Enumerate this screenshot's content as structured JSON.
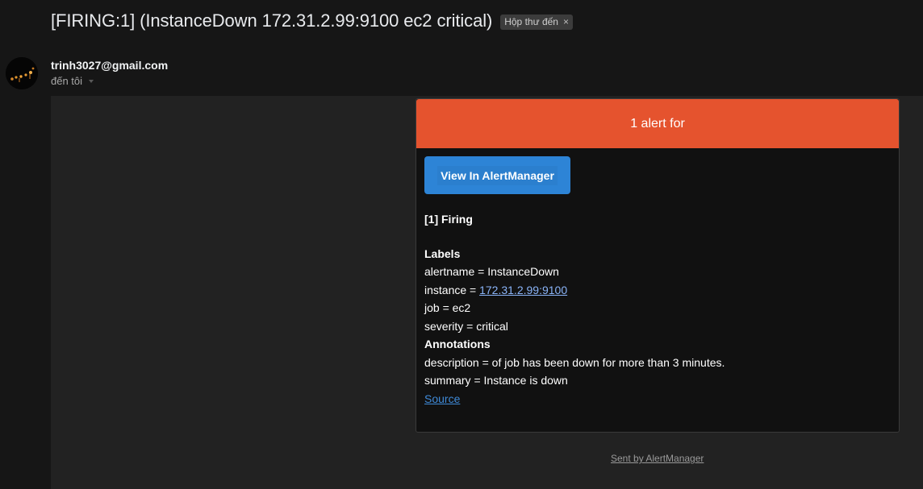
{
  "email": {
    "subject": "[FIRING:1] (InstanceDown 172.31.2.99:9100 ec2 critical)",
    "label_chip": "Hộp thư đến",
    "label_chip_close": "×",
    "sender": "trinh3027@gmail.com",
    "recipient": "đến tôi"
  },
  "alert": {
    "header": "1 alert for",
    "button_label": "View In AlertManager",
    "firing_title": "[1] Firing",
    "labels_heading": "Labels",
    "labels": {
      "alertname": "alertname = InstanceDown",
      "instance_prefix": "instance = ",
      "instance_link": "172.31.2.99:9100",
      "job": "job = ec2",
      "severity": "severity = critical"
    },
    "annotations_heading": "Annotations",
    "annotations": {
      "description": "description = of job has been down for more than 3 minutes.",
      "summary": "summary = Instance is down"
    },
    "source_link": "Source"
  },
  "footer": {
    "sent_by": "Sent by AlertManager"
  },
  "colors": {
    "alert_header": "#e5532e",
    "button": "#2d84d6",
    "link": "#8ab4f8"
  }
}
